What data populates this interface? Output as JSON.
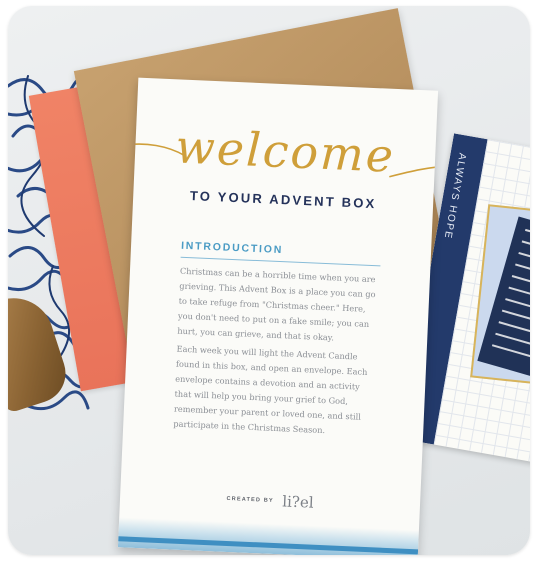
{
  "card": {
    "script_title": "welcome",
    "subtitle": "TO YOUR ADVENT BOX",
    "section_heading": "INTRODUCTION",
    "paragraph_1": "Christmas can be a horrible time when you are grieving. This Advent Box is a place you can go to take refuge from \"Christmas cheer.\" Here, you don't need to put on a fake smile; you can hurt, you can grieve, and that is okay.",
    "paragraph_2": "Each week you will light the Advent Candle found in this box, and open an envelope. Each envelope contains a devotion and an activity that will help you bring your grief to God, remember your parent or loved one, and still participate in the Christmas Season.",
    "credit_label": "CREATED BY",
    "credit_brand": "li?el"
  },
  "book": {
    "spine_text": "ALWAYS HOPE"
  },
  "colors": {
    "gold": "#cf9f3a",
    "navy": "#24325a",
    "accent_blue": "#4a9bc4",
    "coral": "#e9735a",
    "kraft": "#b68f5e"
  }
}
